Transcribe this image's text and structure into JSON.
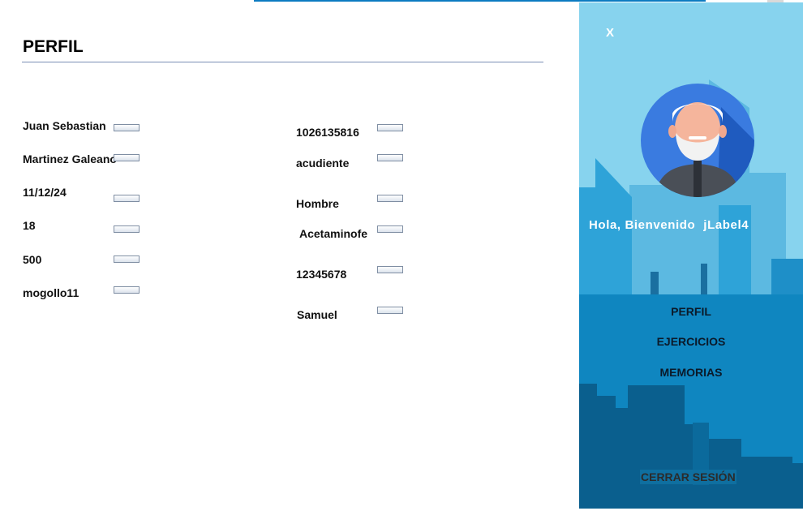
{
  "page": {
    "title": "PERFIL"
  },
  "left_fields": [
    "Juan Sebastian",
    "Martinez Galeano",
    "11/12/24",
    "18",
    "500",
    "mogollo11"
  ],
  "right_fields": [
    "1026135816",
    "acudiente",
    "Hombre",
    "Acetaminofe",
    "12345678",
    "Samuel"
  ],
  "sidebar": {
    "close_label": "X",
    "welcome": "Hola, Bienvenido",
    "user_label": "jLabel4",
    "menu": [
      "PERFIL",
      "EJERCICIOS",
      "MEMORIAS"
    ],
    "logout_label": "CERRAR SESIÓN"
  },
  "colors": {
    "accent": "#0b7bc1",
    "sky": "#87d3ee",
    "city_mid": "#0f86c0",
    "city_dark": "#0a5f8e"
  }
}
